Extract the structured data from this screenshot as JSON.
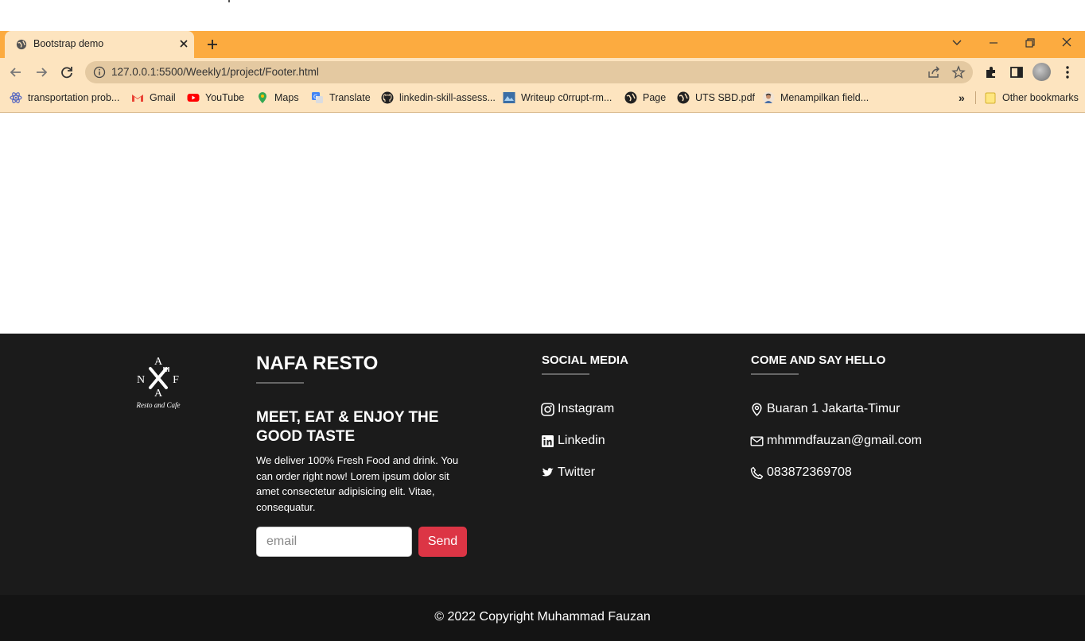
{
  "browser": {
    "tab_title": "Bootstrap demo",
    "url": "127.0.0.1:5500/Weekly1/project/Footer.html",
    "bookmarks": [
      {
        "label": "transportation prob...",
        "icon": "atom-icon"
      },
      {
        "label": "Gmail",
        "icon": "gmail-icon"
      },
      {
        "label": "YouTube",
        "icon": "youtube-icon"
      },
      {
        "label": "Maps",
        "icon": "maps-icon"
      },
      {
        "label": "Translate",
        "icon": "translate-icon"
      },
      {
        "label": "linkedin-skill-assess...",
        "icon": "github-icon"
      },
      {
        "label": "Writeup c0rrupt-rm...",
        "icon": "site-icon"
      },
      {
        "label": "Page",
        "icon": "globe-icon"
      },
      {
        "label": "UTS SBD.pdf",
        "icon": "globe-icon"
      },
      {
        "label": "Menampilkan field...",
        "icon": "avatar-icon"
      }
    ],
    "overflow_label": "»",
    "other_bookmarks": "Other bookmarks",
    "colors": {
      "tab_strip": "#fcab40",
      "toolbar": "#fde4bf",
      "omnibox": "#e4c9a1"
    }
  },
  "footer": {
    "logo": {
      "letters": [
        "A",
        "N",
        "F",
        "A"
      ],
      "subtitle": "Resto and Cafe"
    },
    "brand": "NAFA RESTO",
    "tagline": "MEET, EAT & ENJOY THE GOOD TASTE",
    "description": "We deliver 100% Fresh Food and drink. You can order right now! Lorem ipsum dolor sit amet consectetur adipisicing elit. Vitae, consequatur.",
    "email_placeholder": "email",
    "send_label": "Send",
    "social": {
      "heading": "SOCIAL MEDIA",
      "links": [
        {
          "label": "Instagram",
          "icon": "instagram-icon"
        },
        {
          "label": "Linkedin",
          "icon": "linkedin-icon"
        },
        {
          "label": "Twitter",
          "icon": "twitter-icon"
        }
      ]
    },
    "contact": {
      "heading": "COME AND SAY HELLO",
      "items": [
        {
          "label": "Buaran 1 Jakarta-Timur",
          "icon": "location-pin-icon"
        },
        {
          "label": "mhmmdfauzan@gmail.com",
          "icon": "envelope-icon"
        },
        {
          "label": "083872369708",
          "icon": "phone-icon"
        }
      ]
    },
    "copyright": "© 2022 Copyright Muhammad Fauzan",
    "colors": {
      "footer_bg": "#1b1b1b",
      "copyright_bg": "#141414",
      "send_button": "#dc3545"
    }
  }
}
